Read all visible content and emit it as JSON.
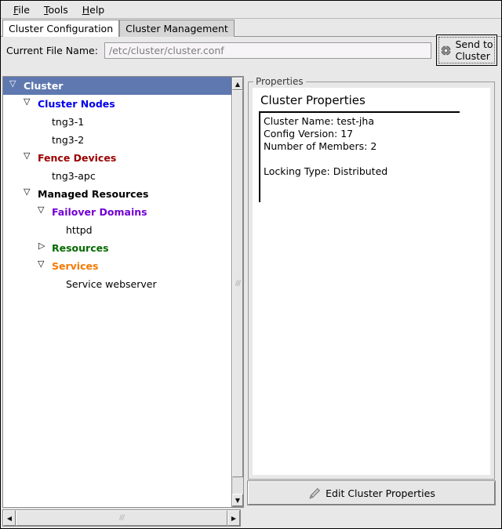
{
  "menubar": {
    "items": [
      {
        "mnemonic": "F",
        "rest": "ile"
      },
      {
        "mnemonic": "T",
        "rest": "ools"
      },
      {
        "mnemonic": "H",
        "rest": "elp"
      }
    ]
  },
  "tabs": [
    {
      "label": "Cluster Configuration",
      "active": true
    },
    {
      "label": "Cluster Management",
      "active": false
    }
  ],
  "file_row": {
    "label": "Current File Name:",
    "value": "/etc/cluster/cluster.conf",
    "placeholder": "/etc/cluster/cluster.conf"
  },
  "send_button": {
    "line1": "Send to",
    "line2": "Cluster",
    "icon": "gear-icon"
  },
  "tree": {
    "items": [
      {
        "label": "Cluster",
        "indent": 0,
        "twisty": "open",
        "bold": true,
        "color": "#ffffff",
        "selected": true
      },
      {
        "label": "Cluster Nodes",
        "indent": 1,
        "twisty": "open",
        "bold": true,
        "color": "#0000e8",
        "selected": false
      },
      {
        "label": "tng3-1",
        "indent": 2,
        "twisty": "none",
        "bold": false,
        "color": "#000000",
        "selected": false
      },
      {
        "label": "tng3-2",
        "indent": 2,
        "twisty": "none",
        "bold": false,
        "color": "#000000",
        "selected": false
      },
      {
        "label": "Fence Devices",
        "indent": 1,
        "twisty": "open",
        "bold": true,
        "color": "#9b0000",
        "selected": false
      },
      {
        "label": "tng3-apc",
        "indent": 2,
        "twisty": "none",
        "bold": false,
        "color": "#000000",
        "selected": false
      },
      {
        "label": "Managed Resources",
        "indent": 1,
        "twisty": "open",
        "bold": true,
        "color": "#000000",
        "selected": false
      },
      {
        "label": "Failover Domains",
        "indent": 2,
        "twisty": "open",
        "bold": true,
        "color": "#7300d3",
        "selected": false
      },
      {
        "label": "httpd",
        "indent": 3,
        "twisty": "none",
        "bold": false,
        "color": "#000000",
        "selected": false
      },
      {
        "label": "Resources",
        "indent": 2,
        "twisty": "closed",
        "bold": true,
        "color": "#056b00",
        "selected": false
      },
      {
        "label": "Services",
        "indent": 2,
        "twisty": "open",
        "bold": true,
        "color": "#f57900",
        "selected": false
      },
      {
        "label": "Service webserver",
        "indent": 3,
        "twisty": "none",
        "bold": false,
        "color": "#000000",
        "selected": false
      }
    ]
  },
  "properties": {
    "group_title": "Properties",
    "heading": "Cluster Properties",
    "lines": [
      "Cluster Name: test-jha",
      "Config Version: 17",
      "Number of Members: 2",
      "",
      "Locking Type: Distributed"
    ]
  },
  "edit_button": {
    "label": "Edit Cluster Properties",
    "icon": "wrench-icon"
  },
  "scrollbars": {
    "up_arrow": "▲",
    "down_arrow": "▼",
    "left_arrow": "◀",
    "right_arrow": "▶",
    "grip": "///"
  },
  "colors": {
    "selection": "#5f79b0",
    "window_bg": "#e8e8e8",
    "panel_bg": "#ffffff"
  }
}
